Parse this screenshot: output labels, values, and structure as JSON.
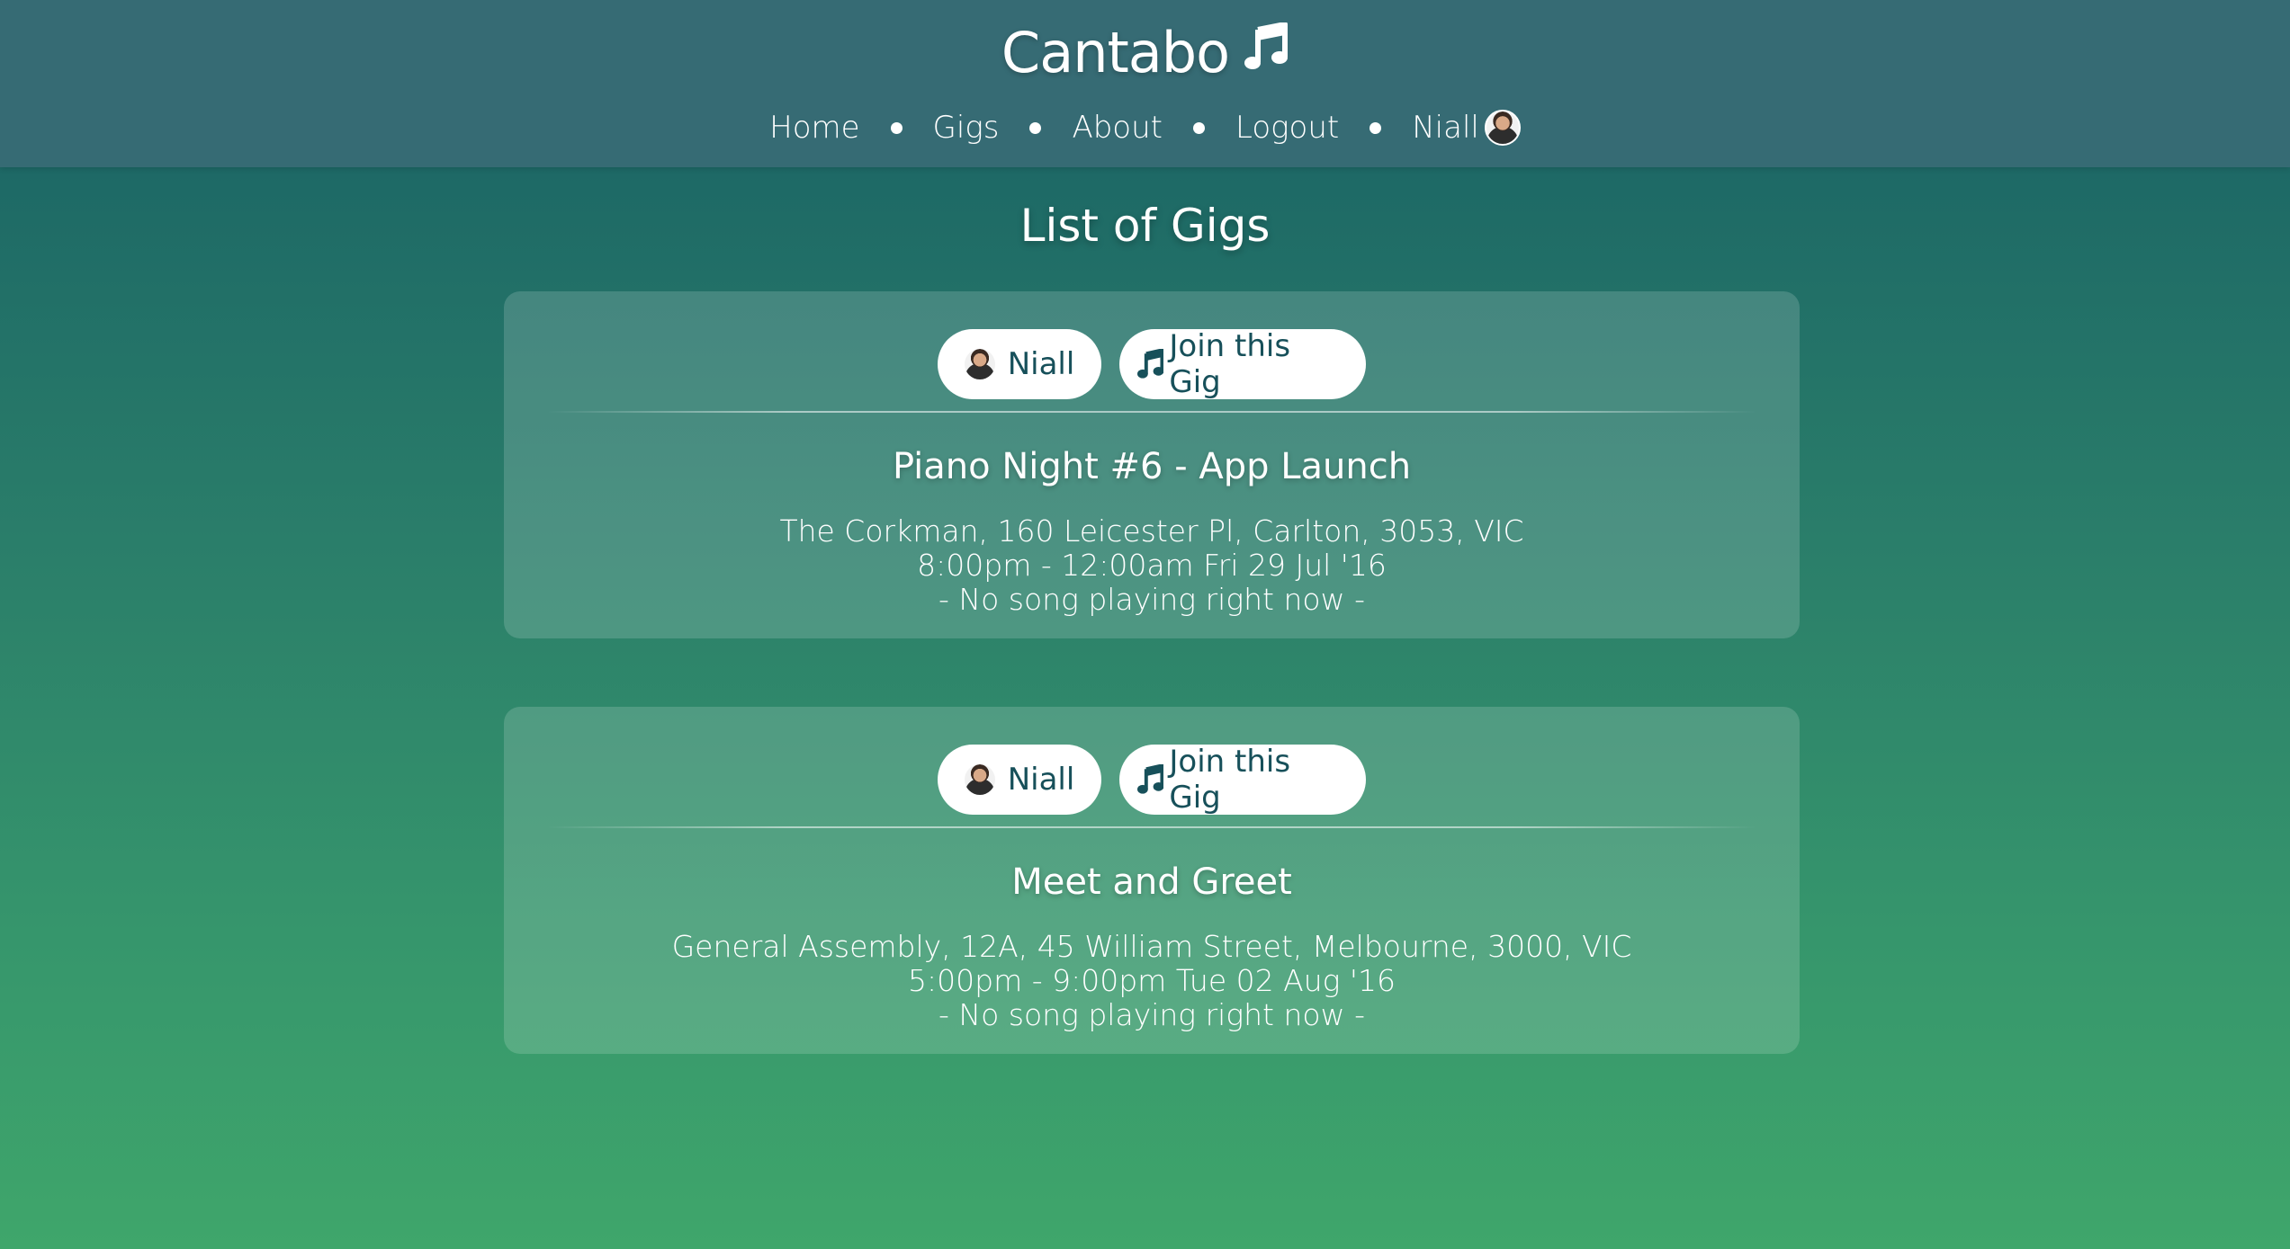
{
  "app": {
    "name": "Cantabo",
    "logo_icon": "music-note-icon"
  },
  "nav": {
    "items": [
      {
        "label": "Home"
      },
      {
        "label": "Gigs"
      },
      {
        "label": "About"
      },
      {
        "label": "Logout"
      }
    ],
    "user": {
      "label": "Niall",
      "avatar_icon": "user-avatar"
    }
  },
  "page": {
    "title": "List of Gigs"
  },
  "gigs": [
    {
      "host_label": "Niall",
      "join_label": "Join this Gig",
      "title": "Piano Night #6 - App Launch",
      "location": "The Corkman, 160 Leicester Pl, Carlton, 3053, VIC",
      "time": "8:00pm - 12:00am Fri 29 Jul '16",
      "now_playing": "- No song playing right now -"
    },
    {
      "host_label": "Niall",
      "join_label": "Join this Gig",
      "title": "Meet and Greet",
      "location": "General Assembly, 12A, 45 William Street, Melbourne, 3000, VIC",
      "time": "5:00pm - 9:00pm Tue 02 Aug '16",
      "now_playing": "- No song playing right now -"
    }
  ],
  "colors": {
    "header_bg": "#366b74",
    "button_text": "#17505a",
    "gradient_top": "#1a5a62",
    "gradient_bottom": "#3fa66b"
  }
}
